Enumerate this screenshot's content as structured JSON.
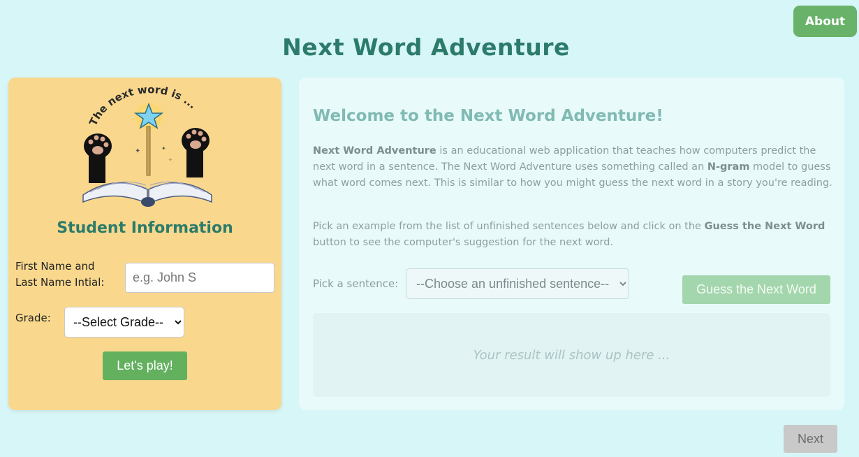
{
  "header": {
    "about_label": "About",
    "title": "Next Word Adventure"
  },
  "logo": {
    "arc_text": "The next word is ..."
  },
  "student": {
    "section_title": "Student Information",
    "name_label_line1": "First Name and",
    "name_label_line2": "Last Name Intial:",
    "name_placeholder": "e.g. John S",
    "grade_label": "Grade:",
    "grade_selected": "--Select Grade--",
    "play_label": "Let's play!"
  },
  "main": {
    "welcome_title": "Welcome to the Next Word Adventure!",
    "p1_bold1": "Next Word Adventure",
    "p1_text1": " is an educational web application that teaches how computers predict the next word in a sentence. The Next Word Adventure uses something called an ",
    "p1_bold2": "N-gram",
    "p1_text2": " model to guess what word comes next. This is similar to how you might guess the next word in a story you're reading.",
    "p2_text1": "Pick an example from the list of unfinished sentences below and click on the ",
    "p2_bold": "Guess the Next Word",
    "p2_text2": " button to see the computer's suggestion for the next word.",
    "pick_label": "Pick a sentence:",
    "sentence_selected": "--Choose an unfinished sentence--",
    "guess_label": "Guess the Next Word",
    "result_placeholder": "Your result will show up here ..."
  },
  "footer": {
    "next_label": "Next"
  },
  "colors": {
    "background": "#d7f6f8",
    "title": "#2c7b6a",
    "left_panel": "#f9d88e",
    "green_button": "#63b05f",
    "disabled_green": "#a3d6ac",
    "next_disabled": "#c9c9c9"
  }
}
